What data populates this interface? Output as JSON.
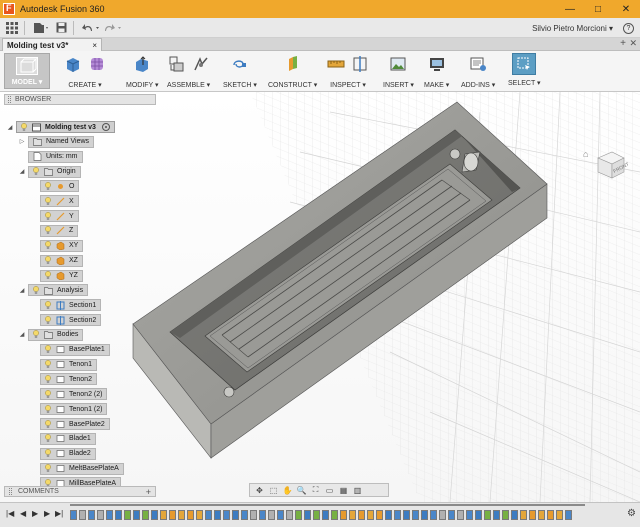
{
  "window": {
    "title": "Autodesk Fusion 360",
    "minimize": "—",
    "maximize": "□",
    "close": "✕"
  },
  "quick_access": {
    "user": "Silvio Pietro Morcioni ▾",
    "help": "?"
  },
  "document_tab": {
    "name": "Molding test v3*",
    "close": "×"
  },
  "ribbon": {
    "workspace": "MODEL ▾",
    "groups": [
      {
        "label": "CREATE ▾"
      },
      {
        "label": "MODIFY ▾"
      },
      {
        "label": "ASSEMBLE ▾"
      },
      {
        "label": "SKETCH ▾"
      },
      {
        "label": "CONSTRUCT ▾"
      },
      {
        "label": "INSPECT ▾"
      },
      {
        "label": "INSERT ▾"
      },
      {
        "label": "MAKE ▾"
      },
      {
        "label": "ADD-INS ▾"
      },
      {
        "label": "SELECT ▾"
      }
    ]
  },
  "browser": {
    "header": "BROWSER",
    "root": "Molding test v3",
    "named_views": "Named Views",
    "units": "Units: mm",
    "origin": {
      "label": "Origin",
      "items": [
        "O",
        "X",
        "Y",
        "Z",
        "XY",
        "XZ",
        "YZ"
      ]
    },
    "analysis": {
      "label": "Analysis",
      "items": [
        "Section1",
        "Section2"
      ]
    },
    "bodies": {
      "label": "Bodies",
      "items": [
        "BasePlate1",
        "Tenon1",
        "Tenon2",
        "Tenon2 (2)",
        "Tenon1 (2)",
        "BasePlate2",
        "Blade1",
        "Blade2",
        "MeltBasePlateA",
        "MillBasePlateA"
      ]
    }
  },
  "comments": {
    "label": "COMMENTS",
    "add": "+"
  },
  "viewcube": {
    "face": "FRONT"
  },
  "colors": {
    "title_bar": "#f0a82c",
    "ribbon_bg": "#f5f5f5",
    "select_accent": "#5c9ec4",
    "model_body": "#8c8c88"
  }
}
